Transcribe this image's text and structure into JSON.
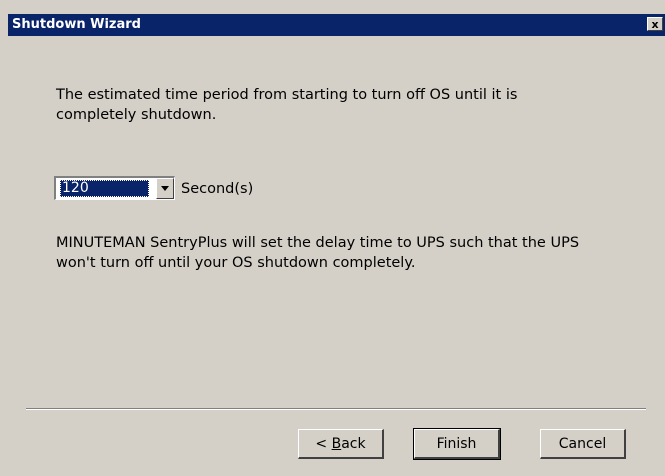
{
  "window": {
    "title": "Shutdown Wizard",
    "close_glyph": "x",
    "title_bg": "#0a246a",
    "body_bg": "#d4d0c8"
  },
  "content": {
    "description": "The estimated time period from starting to turn off OS until it is completely shutdown.",
    "delay_select": {
      "value": "120",
      "unit_label": "Second(s)"
    },
    "info": "MINUTEMAN SentryPlus will set the delay time to UPS such that the UPS won't turn off until your OS shutdown completely."
  },
  "buttons": {
    "back_prefix": "< ",
    "back_mnemonic": "B",
    "back_rest": "ack",
    "finish": "Finish",
    "cancel": "Cancel"
  }
}
